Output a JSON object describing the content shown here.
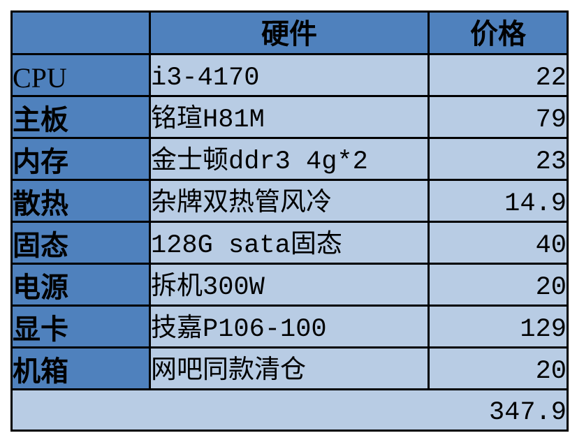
{
  "colors": {
    "header_bg": "#4f81bd",
    "category_bg": "#4f81bd",
    "data_bg": "#b8cce4",
    "border": "#000000",
    "text": "#000000"
  },
  "table": {
    "headers": [
      "",
      "硬件",
      "价格"
    ],
    "rows": [
      {
        "category": "CPU",
        "item": "i3-4170",
        "price": "22"
      },
      {
        "category": "主板",
        "item": "铭瑄H81M",
        "price": "79"
      },
      {
        "category": "内存",
        "item": "金士顿ddr3 4g*2",
        "price": "23"
      },
      {
        "category": "散热",
        "item": "杂牌双热管风冷",
        "price": "14.9"
      },
      {
        "category": "固态",
        "item": "128G sata固态",
        "price": "40"
      },
      {
        "category": "电源",
        "item": "拆机300W",
        "price": "20"
      },
      {
        "category": "显卡",
        "item": "技嘉P106-100",
        "price": "129"
      },
      {
        "category": "机箱",
        "item": "网吧同款清仓",
        "price": "20"
      }
    ],
    "total": "347.9"
  }
}
